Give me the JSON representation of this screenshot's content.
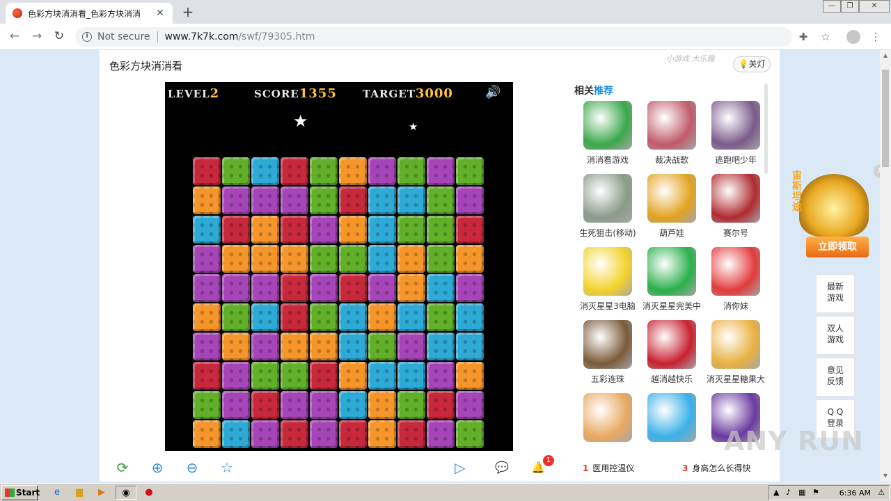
{
  "browser": {
    "tab_title": "色彩方块消消看_色彩方块消消",
    "tab_close": "✕",
    "new_tab": "+",
    "win_min": "—",
    "win_max": "❐",
    "win_close": "✕",
    "back": "←",
    "forward": "→",
    "reload": "↻",
    "security_label": "Not secure",
    "url_host": "www.7k7k.com",
    "url_path": "/swf/79305.htm",
    "info_glyph": "i",
    "ext_glyph": "✚",
    "bookmark_glyph": "☆",
    "menu_glyph": "⋮"
  },
  "page": {
    "game_title": "色彩方块消消看",
    "slogan": "小游戏 大乐趣",
    "light_button": "💡关灯"
  },
  "game": {
    "level_label": "LEVEL",
    "level_value": "2",
    "score_label": "SCORE",
    "score_value": "1355",
    "target_label": "TARGET",
    "target_value": "3000",
    "sound_glyph": "🔊",
    "star_glyph": "★",
    "colors": {
      "R": "#c8283c",
      "G": "#62b02a",
      "B": "#2eaad6",
      "O": "#f6962a",
      "P": "#a645b8"
    },
    "grid": [
      "RGBRGOPGPG",
      "OPPPGRBBGP",
      "BRORPOBGGR",
      "POOOGGBOGO",
      "PPPRPRPOBP",
      "OGBRGBOBGB",
      "POPOOBGPBB",
      "RPGGROBBPO",
      "GPRPPBOGRP",
      "OBPRPRORPG"
    ]
  },
  "controls": {
    "refresh_glyph": "⟳",
    "zoom_in_glyph": "⊕",
    "zoom_out_glyph": "⊖",
    "favorite_glyph": "☆",
    "play_glyph": "▷",
    "chat_glyph": "💬",
    "notify_glyph": "🔔",
    "notify_count": "1"
  },
  "related": {
    "heading_a": "相关",
    "heading_b": "推荐",
    "items": [
      {
        "name": "消消看游戏",
        "color": "#3aa84a"
      },
      {
        "name": "裁决战歌",
        "color": "#c05a6a"
      },
      {
        "name": "逃跑吧少年",
        "color": "#7a5a8a"
      },
      {
        "name": "生死狙击(移动)",
        "color": "#8a9a8a"
      },
      {
        "name": "葫芦娃",
        "color": "#e2a220"
      },
      {
        "name": "赛尔号",
        "color": "#b02a30"
      },
      {
        "name": "消灭星星3电脑",
        "color": "#f2d32a"
      },
      {
        "name": "消灭星星完美中",
        "color": "#2ab04a"
      },
      {
        "name": "消你妹",
        "color": "#e23a3a"
      },
      {
        "name": "五彩连珠",
        "color": "#7a5a3a"
      },
      {
        "name": "越消越快乐",
        "color": "#c82030"
      },
      {
        "name": "消灭星星糖果大",
        "color": "#e8b040"
      },
      {
        "name": "",
        "color": "#e8a860"
      },
      {
        "name": "",
        "color": "#3ab0e8"
      },
      {
        "name": "",
        "color": "#6a3aa0"
      }
    ]
  },
  "news": [
    {
      "num": "1",
      "text": "医用控温仪"
    },
    {
      "num": "3",
      "text": "身高怎么长得快"
    }
  ],
  "ad": {
    "vertical_text": "宙斯坦途",
    "button": "立即领取",
    "close": "✕"
  },
  "sidenav": [
    {
      "line1": "最新",
      "line2": "游戏"
    },
    {
      "line1": "双人",
      "line2": "游戏"
    },
    {
      "line1": "意见",
      "line2": "反馈"
    },
    {
      "line1": "Q Q",
      "line2": "登录"
    }
  ],
  "watermark": "ANY RUN",
  "taskbar": {
    "start_label": "Start",
    "clock": "6:36 AM"
  }
}
